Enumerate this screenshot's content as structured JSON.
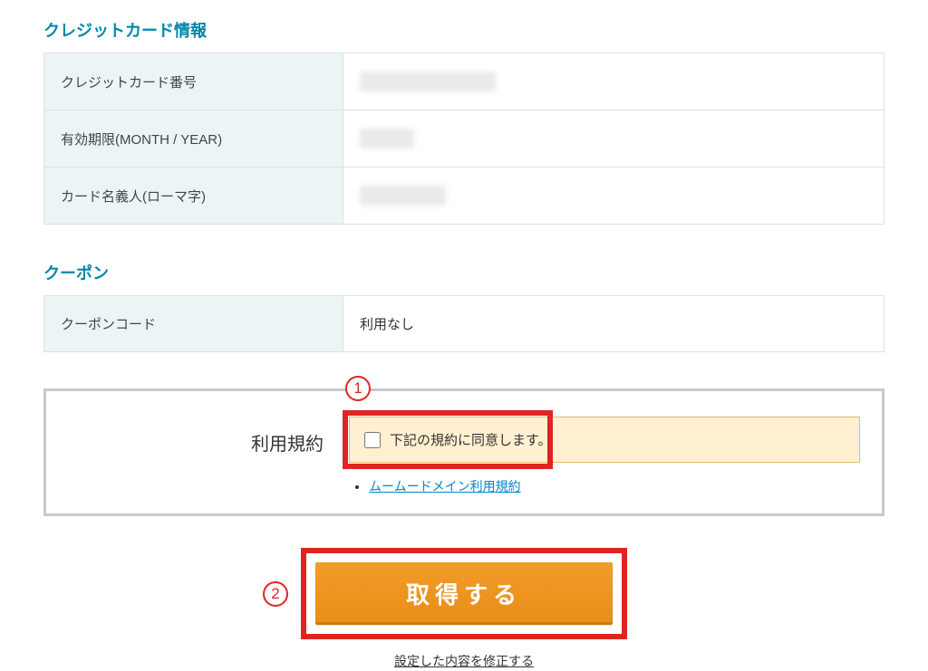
{
  "credit_card": {
    "section_title": "クレジットカード情報",
    "rows": [
      {
        "label": "クレジットカード番号"
      },
      {
        "label": "有効期限(MONTH / YEAR)"
      },
      {
        "label": "カード名義人(ローマ字)"
      }
    ]
  },
  "coupon": {
    "section_title": "クーポン",
    "rows": [
      {
        "label": "クーポンコード",
        "value": "利用なし"
      }
    ]
  },
  "terms": {
    "label": "利用規約",
    "agree_text": "下記の規約に同意します。",
    "link_text": "ムームードメイン利用規約"
  },
  "submit": {
    "button_label": "取得する",
    "edit_link_text": "設定した内容を修正する"
  },
  "annotations": {
    "step1": "1",
    "step2": "2"
  }
}
